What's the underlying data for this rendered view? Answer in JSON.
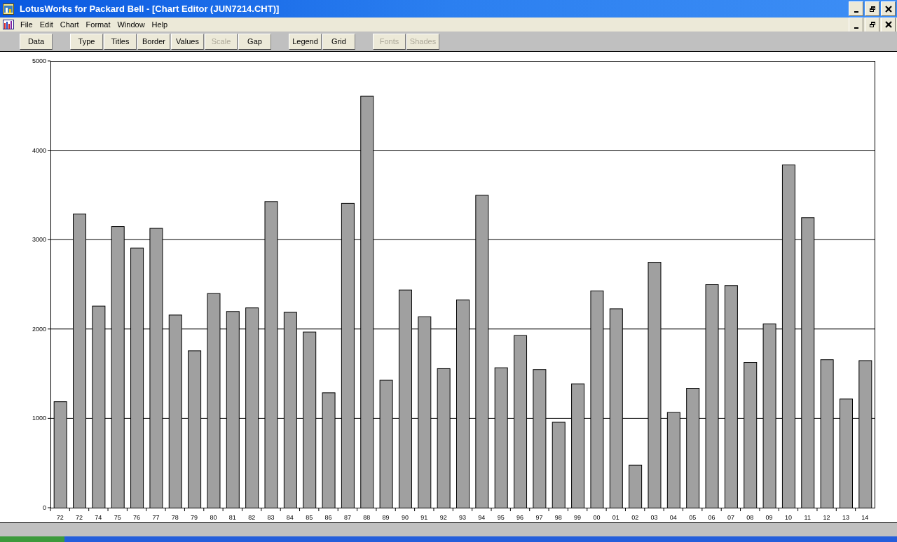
{
  "window": {
    "title": "LotusWorks for Packard Bell - [Chart Editor (JUN7214.CHT)]"
  },
  "menu": [
    "File",
    "Edit",
    "Chart",
    "Format",
    "Window",
    "Help"
  ],
  "toolbar": [
    [
      {
        "label": "Data",
        "disabled": false
      }
    ],
    [
      {
        "label": "Type",
        "disabled": false
      },
      {
        "label": "Titles",
        "disabled": false
      },
      {
        "label": "Border",
        "disabled": false
      },
      {
        "label": "Values",
        "disabled": false
      },
      {
        "label": "Scale",
        "disabled": true
      },
      {
        "label": "Gap",
        "disabled": false
      }
    ],
    [
      {
        "label": "Legend",
        "disabled": false
      },
      {
        "label": "Grid",
        "disabled": false
      }
    ],
    [
      {
        "label": "Fonts",
        "disabled": true
      },
      {
        "label": "Shades",
        "disabled": true
      }
    ]
  ],
  "chart": {
    "chart_data": {
      "type": "bar",
      "categories": [
        "72",
        "72",
        "74",
        "75",
        "76",
        "77",
        "78",
        "79",
        "80",
        "81",
        "82",
        "83",
        "84",
        "85",
        "86",
        "87",
        "88",
        "89",
        "90",
        "91",
        "92",
        "93",
        "94",
        "95",
        "96",
        "97",
        "98",
        "99",
        "00",
        "01",
        "02",
        "03",
        "04",
        "05",
        "06",
        "07",
        "08",
        "09",
        "10",
        "11",
        "12",
        "13",
        "14"
      ],
      "series": [
        {
          "color": "#a0a0a0",
          "values": [
            1190,
            3290,
            2260,
            3150,
            2910,
            3130,
            2160,
            1760,
            2400,
            2200,
            2240,
            3430,
            2190,
            1970,
            1290,
            3410,
            4610,
            1430,
            2440,
            2140,
            1560,
            2330,
            3500,
            1570,
            1930,
            1550,
            960,
            1390,
            2430,
            2230,
            480,
            2750,
            1070,
            1340,
            2500,
            2490,
            1630,
            2060,
            3840,
            3250,
            1660,
            1220,
            1650
          ]
        }
      ],
      "ylim": [
        0,
        5000
      ],
      "yticks": [
        0,
        1000,
        2000,
        3000,
        4000,
        5000
      ],
      "orientation": "vertical",
      "grid": true
    }
  }
}
